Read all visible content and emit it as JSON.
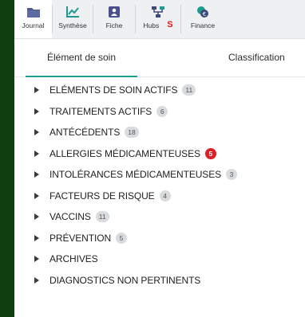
{
  "toolbar": {
    "items": [
      {
        "label": "Journal",
        "icon": "folder-icon"
      },
      {
        "label": "Synthèse",
        "icon": "chart-line-icon"
      },
      {
        "label": "Fiche",
        "icon": "id-card-icon"
      },
      {
        "label": "Hubs",
        "icon": "hubs-icon",
        "flag": "S"
      },
      {
        "label": "Finance",
        "icon": "finance-icon"
      }
    ]
  },
  "tabs": [
    {
      "label": "Élément de soin",
      "active": true
    },
    {
      "label": "Classification",
      "active": false
    }
  ],
  "sections": [
    {
      "label": "ELÉMENTS DE SOIN ACTIFS",
      "count": "11",
      "alert": false
    },
    {
      "label": "TRAITEMENTS ACTIFS",
      "count": "6",
      "alert": false
    },
    {
      "label": "ANTÉCÉDENTS",
      "count": "18",
      "alert": false
    },
    {
      "label": "ALLERGIES MÉDICAMENTEUSES",
      "count": "5",
      "alert": true
    },
    {
      "label": "INTOLÉRANCES MÉDICAMENTEUSES",
      "count": "3",
      "alert": false
    },
    {
      "label": "FACTEURS DE RISQUE",
      "count": "4",
      "alert": false
    },
    {
      "label": "VACCINS",
      "count": "11",
      "alert": false
    },
    {
      "label": "PRÉVENTION",
      "count": "5",
      "alert": false
    },
    {
      "label": "ARCHIVES",
      "count": "",
      "alert": false
    },
    {
      "label": "DIAGNOSTICS NON PERTINENTS",
      "count": "",
      "alert": false
    }
  ],
  "colors": {
    "accent": "#1c9c8e",
    "alert_badge": "#dd1f26",
    "hubs_flag": "#e4161e",
    "outer_background": "#0e3d10"
  }
}
